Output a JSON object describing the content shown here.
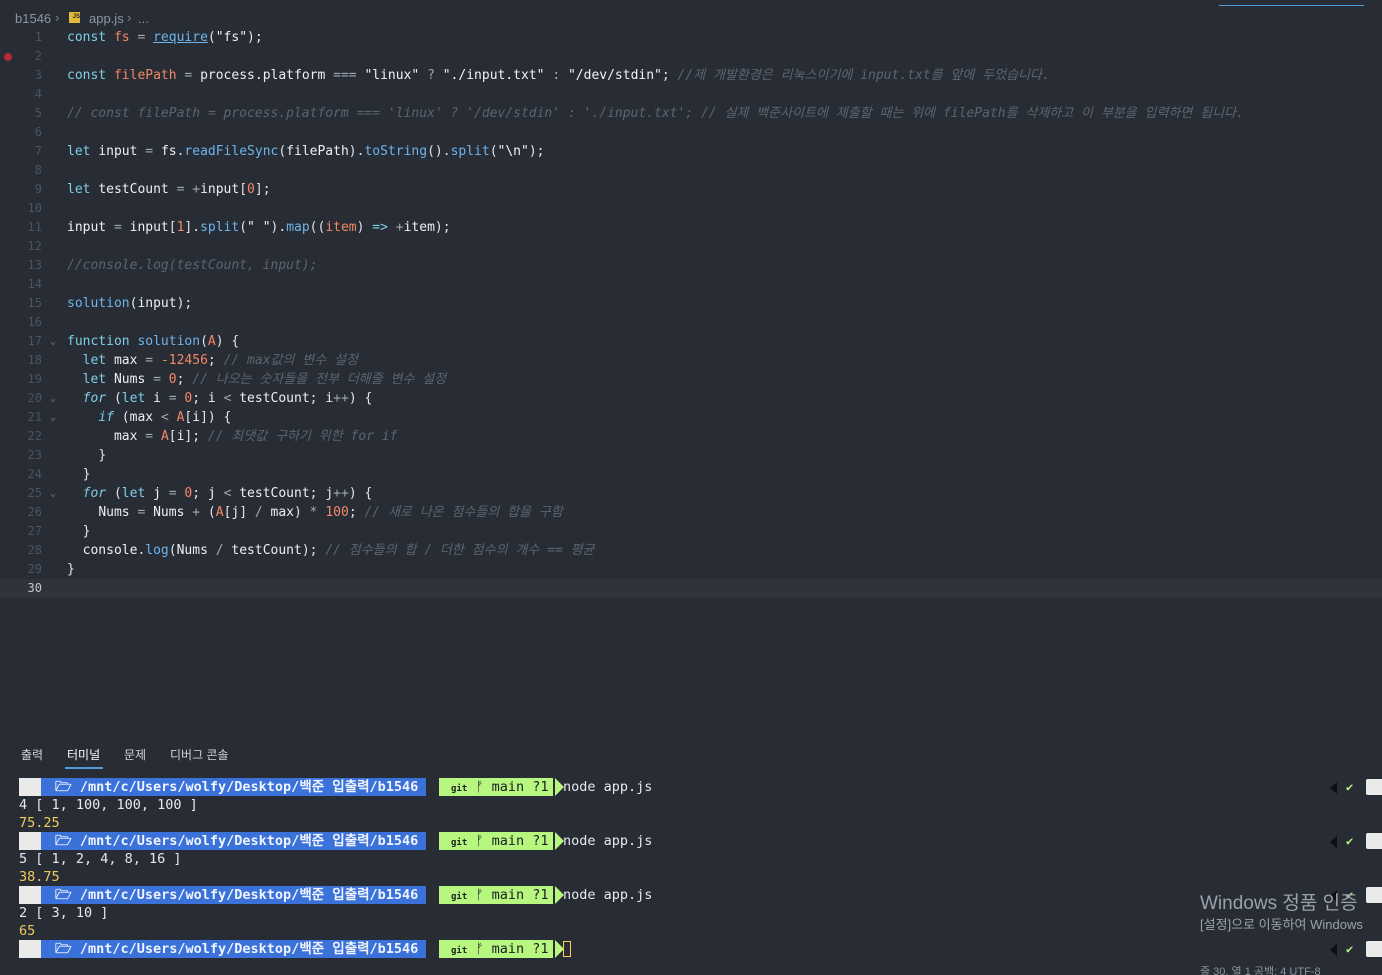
{
  "breadcrumb": {
    "folder": "b1546",
    "file": "app.js",
    "more": "...",
    "file_icon": "JS"
  },
  "editor": {
    "current_line": "30",
    "line_numbers": [
      "1",
      "2",
      "3",
      "4",
      "5",
      "6",
      "7",
      "8",
      "9",
      "10",
      "11",
      "12",
      "13",
      "14",
      "15",
      "16",
      "17",
      "18",
      "19",
      "20",
      "21",
      "22",
      "23",
      "24",
      "25",
      "26",
      "27",
      "28",
      "29",
      "30"
    ]
  },
  "code_text": {
    "comment3": "//제 개발환경은 리눅스이기에 input.txt를 앞에 두었습니다.",
    "comment5": "// const filePath = process.platform === 'linux' ? '/dev/stdin' : './input.txt'; // 실제 백준사이트에 제출할 때는 위에 filePath를 삭제하고 이 부분을 입력하면 됩니다.",
    "comment13": "//console.log(testCount, input);",
    "comment18": "// max값의 변수 설정",
    "comment19": "// 나오는 숫자들을 전부 더해줄 변수 설정",
    "comment22": "// 최댓값 구하기 위한 for if",
    "comment26": "// 새로 나온 점수들의 합을 구함",
    "comment28": "// 점수들의 합 / 더한 점수의 개수 == 평균"
  },
  "panel": {
    "tabs": [
      "출력",
      "터미널",
      "문제",
      "디버그 콘솔"
    ],
    "active_tab": "터미널"
  },
  "terminal": {
    "os_icon": "",
    "prompt_path": "🗁 /mnt/c/Users/wolfy/Desktop/백준 입출력/b1546",
    "git_label": "git",
    "branch": "main ?1",
    "branch_icon": "ᚠ",
    "command": "node app.js",
    "status_check": "✔",
    "runs": [
      {
        "output_line": "4 [ 1, 100, 100, 100 ]",
        "result": "75.25"
      },
      {
        "output_line": "5 [ 1, 2, 4, 8, 16 ]",
        "result": "38.75"
      },
      {
        "output_line": "2 [ 3, 10 ]",
        "result": "65"
      }
    ]
  },
  "watermark": {
    "title": "Windows 정품 인증",
    "subtitle": "[설정]으로 이동하여 Windows"
  },
  "statusbar": {
    "text": "줄 30, 열 1    공백: 4    UTF-8"
  },
  "colors": {
    "background": "#282d35",
    "keyword": "#7fcde7",
    "number": "#f38866",
    "comment": "#5c6470",
    "prompt_path_bg": "#3b72d9",
    "git_bg": "#b7f77f",
    "output_yellow": "#efcb5b"
  }
}
